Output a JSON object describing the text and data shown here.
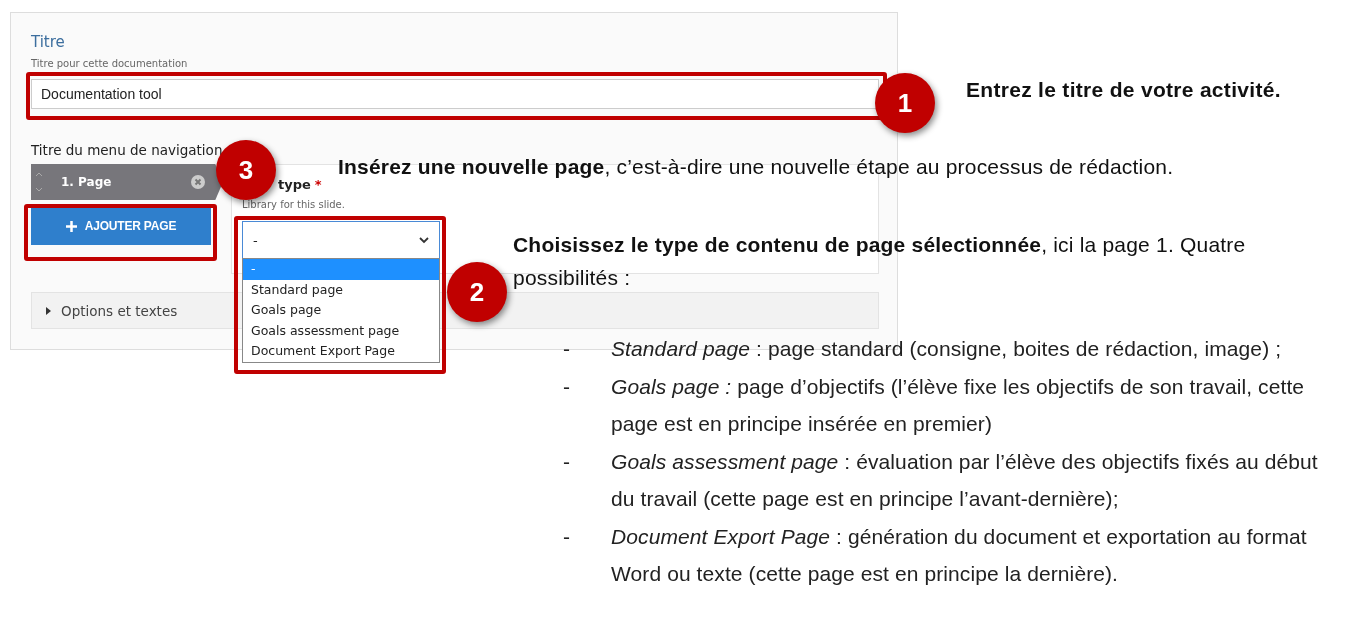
{
  "form": {
    "title_label": "Titre",
    "title_hint": "Titre pour cette documentation",
    "title_value": "Documentation tool",
    "nav_label": "Titre du menu de navigation",
    "pages": [
      {
        "label": "1. Page",
        "selected": true
      }
    ],
    "add_button": "AJOUTER PAGE",
    "type_label": "type",
    "type_required": "*",
    "type_hint": "Library for this slide.",
    "type_value": "-",
    "type_options": [
      {
        "label": "-",
        "selected": true
      },
      {
        "label": "Standard page",
        "selected": false
      },
      {
        "label": "Goals page",
        "selected": false
      },
      {
        "label": "Goals assessment page",
        "selected": false
      },
      {
        "label": "Document Export Page",
        "selected": false
      }
    ],
    "options_section": {
      "label": "Options et textes",
      "expanded": false
    }
  },
  "callouts": [
    "1",
    "3",
    "2"
  ],
  "notes": {
    "title_note": "Entrez le titre de votre activité.",
    "page_note": "**Insérez une nouvelle page**, c’est-à-dire une nouvelle étape au processus de rédaction.",
    "type_note": "**Choisissez le type de contenu de page sélectionnée**, ici la page 1. Quatre possibilités :",
    "items": [
      {
        "marker": "-",
        "text": "*Standard page* : page standard (consigne, boites de rédaction, image) ;"
      },
      {
        "marker": "-",
        "text": "*Goals page :* page d’objectifs (l’élève fixe les objectifs de son travail, cette page est en principe insérée en premier)"
      },
      {
        "marker": "-",
        "text": "*Goals assessment page* : évaluation par l’élève des objectifs fixés au début du travail (cette page est en principe l’avant-dernière);"
      },
      {
        "marker": "-",
        "text": "*Document Export Page* : génération du document et exportation au format Word ou texte (cette page est en principe la dernière)."
      }
    ]
  }
}
